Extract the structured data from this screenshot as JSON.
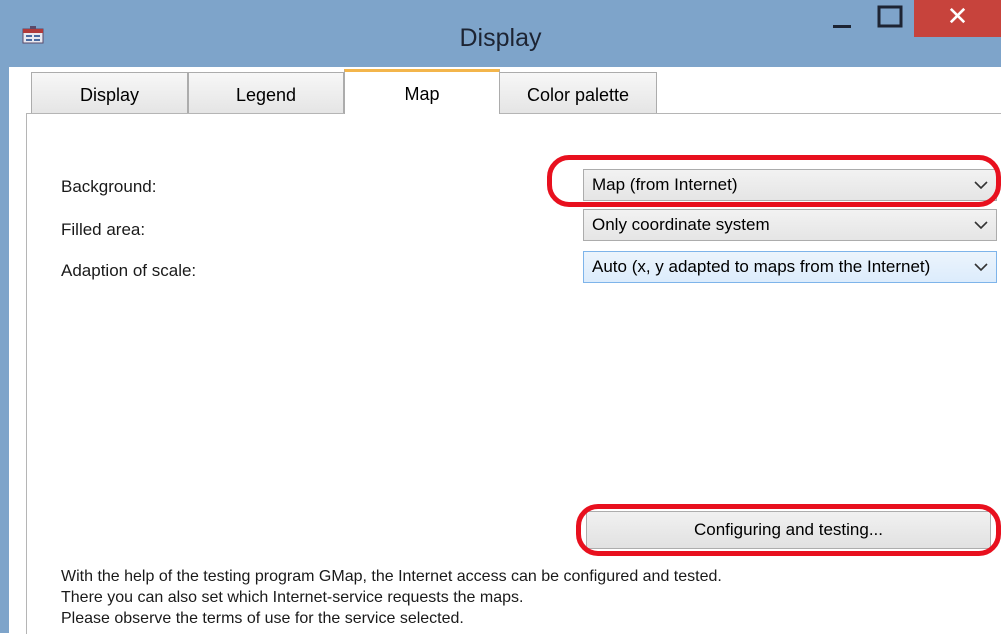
{
  "window": {
    "title": "Display",
    "close_glyph": "✕"
  },
  "tabs": [
    {
      "label": "Display"
    },
    {
      "label": "Legend"
    },
    {
      "label": "Map"
    },
    {
      "label": "Color palette"
    }
  ],
  "active_tab": "Map",
  "fields": {
    "background": {
      "label": "Background:",
      "value": "Map (from Internet)"
    },
    "filled_area": {
      "label": "Filled area:",
      "value": "Only coordinate system"
    },
    "adaption": {
      "label": "Adaption of scale:",
      "value": "Auto (x, y adapted to maps from the Internet)"
    }
  },
  "configure_button": {
    "label": "Configuring and testing..."
  },
  "info_lines": [
    "With the help of the testing program GMap, the Internet access can be configured and tested.",
    "There you can also set which Internet-service requests the maps.",
    "Please observe the terms of use for the service selected."
  ],
  "icons": [
    "app-icon",
    "minimize-icon",
    "maximize-icon",
    "close-icon",
    "chevron-down-icon"
  ],
  "colors": {
    "titlebar": "#7ea4ca",
    "close": "#c7433c",
    "highlight": "#e8101e",
    "active_tab_accent": "#f3b54b"
  }
}
